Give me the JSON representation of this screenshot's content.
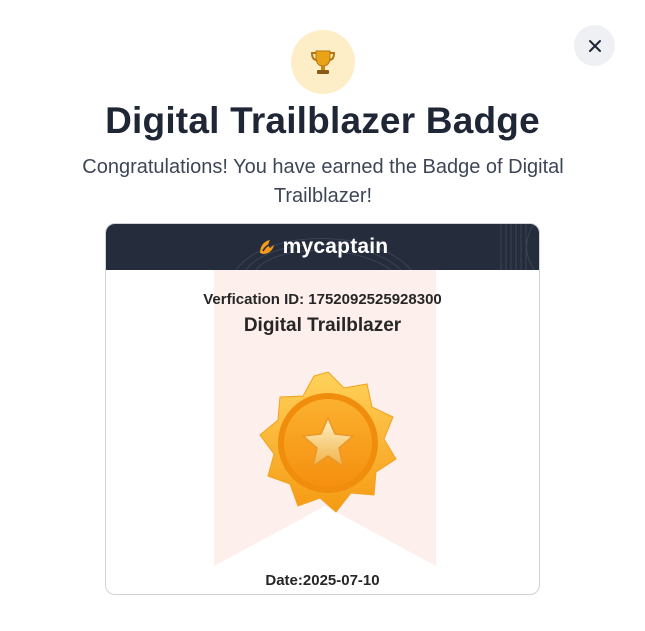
{
  "dialog": {
    "title": "Digital Trailblazer Badge",
    "subtitle": "Congratulations! You have earned the Badge of Digital Trailblazer!",
    "close_icon": "close-icon",
    "trophy_icon": "trophy-icon"
  },
  "certificate": {
    "brand": "mycaptain",
    "brand_icon": "mycaptain-logo-icon",
    "verification_text": "Verfication ID: 1752092525928300",
    "badge_name": "Digital Trailblazer",
    "medal_icon": "star-medal-icon",
    "date_text": "Date:2025-07-10"
  },
  "colors": {
    "header_bg": "#252c3b",
    "ribbon": "#fdefec",
    "medal_orange": "#f7a21c",
    "trophy_bg": "#fdeec8"
  }
}
